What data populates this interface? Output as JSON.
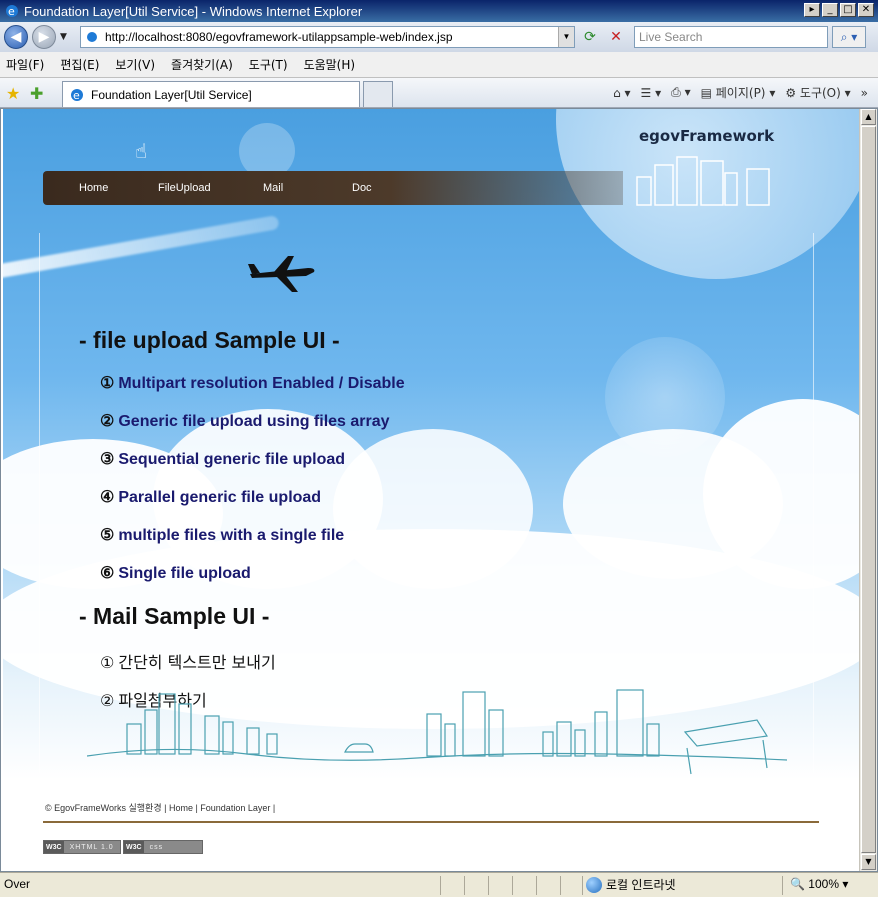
{
  "window": {
    "title": "Foundation Layer[Util Service] - Windows Internet Explorer",
    "controls": [
      "▸",
      "_",
      "□",
      "✕"
    ]
  },
  "address_bar": {
    "url": "http://localhost:8080/egovframework-utilappsample-web/index.jsp",
    "search_placeholder": "Live Search"
  },
  "menu": [
    "파일(F)",
    "편집(E)",
    "보기(V)",
    "즐겨찾기(A)",
    "도구(T)",
    "도움말(H)"
  ],
  "tab": {
    "title": "Foundation Layer[Util Service]"
  },
  "toolbar": {
    "page_label": "페이지(P)",
    "tools_label": "도구(O)",
    "chevron": "»"
  },
  "page": {
    "logo": "egovFramework",
    "nav": [
      "Home",
      "FileUpload",
      "Mail",
      "Doc"
    ],
    "file_section_title": "- file upload Sample UI -",
    "file_links": [
      {
        "num": "①",
        "text": "Multipart resolution Enabled / Disable"
      },
      {
        "num": "②",
        "text": "Generic file upload using files array"
      },
      {
        "num": "③",
        "text": "Sequential generic file upload"
      },
      {
        "num": "④",
        "text": "Parallel generic file upload"
      },
      {
        "num": "⑤",
        "text": "multiple files with a single file"
      },
      {
        "num": "⑥",
        "text": "Single file upload"
      }
    ],
    "mail_section_title": "- Mail Sample UI -",
    "mail_links": [
      {
        "num": "①",
        "text": "간단히 텍스트만 보내기"
      },
      {
        "num": "②",
        "text": "파일첨부하기"
      }
    ],
    "footer": "© EgovFrameWorks 실행환경 | Home | Foundation Layer |",
    "badges": [
      {
        "logo": "W3C",
        "label": "XHTML 1.0"
      },
      {
        "logo": "W3C",
        "label": "css"
      }
    ]
  },
  "status": {
    "text": "Over",
    "zone": "로컬 인트라넷",
    "zoom": "100%"
  }
}
